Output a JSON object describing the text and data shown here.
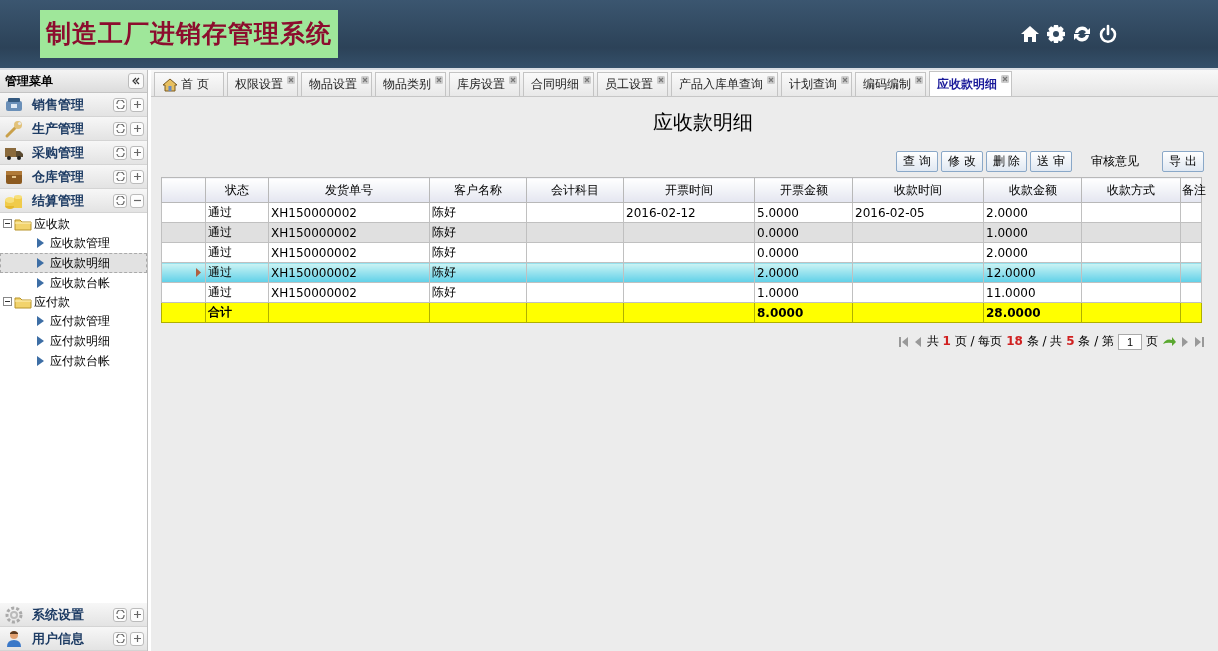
{
  "header": {
    "title": "制造工厂进销存管理系统"
  },
  "sidebar": {
    "title": "管理菜单",
    "groups": [
      {
        "label": "销售管理",
        "expanded": false
      },
      {
        "label": "生产管理",
        "expanded": false
      },
      {
        "label": "采购管理",
        "expanded": false
      },
      {
        "label": "仓库管理",
        "expanded": false
      },
      {
        "label": "结算管理",
        "expanded": true,
        "tree": [
          {
            "label": "应收款",
            "expanded": true,
            "children": [
              {
                "label": "应收款管理",
                "selected": false
              },
              {
                "label": "应收款明细",
                "selected": true
              },
              {
                "label": "应收款台帐",
                "selected": false
              }
            ]
          },
          {
            "label": "应付款",
            "expanded": true,
            "children": [
              {
                "label": "应付款管理",
                "selected": false
              },
              {
                "label": "应付款明细",
                "selected": false
              },
              {
                "label": "应付款台帐",
                "selected": false
              }
            ]
          }
        ]
      }
    ],
    "bottom_groups": [
      {
        "label": "系统设置",
        "expanded": false
      },
      {
        "label": "用户信息",
        "expanded": false
      }
    ]
  },
  "tabs": [
    {
      "label": "首 页",
      "selected": false,
      "closable": false
    },
    {
      "label": "权限设置",
      "selected": false,
      "closable": true
    },
    {
      "label": "物品设置",
      "selected": false,
      "closable": true
    },
    {
      "label": "物品类别",
      "selected": false,
      "closable": true
    },
    {
      "label": "库房设置",
      "selected": false,
      "closable": true
    },
    {
      "label": "合同明细",
      "selected": false,
      "closable": true
    },
    {
      "label": "员工设置",
      "selected": false,
      "closable": true
    },
    {
      "label": "产品入库单查询",
      "selected": false,
      "closable": true
    },
    {
      "label": "计划查询",
      "selected": false,
      "closable": true
    },
    {
      "label": "编码编制",
      "selected": false,
      "closable": true
    },
    {
      "label": "应收款明细",
      "selected": true,
      "closable": true
    }
  ],
  "page_title": "应收款明细",
  "toolbar": [
    {
      "kind": "button",
      "label": "查 询"
    },
    {
      "kind": "button",
      "label": "修 改"
    },
    {
      "kind": "button",
      "label": "删 除"
    },
    {
      "kind": "button",
      "label": "送 审"
    },
    {
      "kind": "label",
      "label": "审核意见"
    },
    {
      "kind": "button",
      "label": "导 出"
    }
  ],
  "table": {
    "columns": [
      "",
      "状态",
      "发货单号",
      "客户名称",
      "会计科目",
      "开票时间",
      "开票金额",
      "收款时间",
      "收款金额",
      "收款方式",
      "备注"
    ],
    "rows": [
      {
        "selected": false,
        "hover": false,
        "cells": [
          "",
          "通过",
          "XH150000002",
          "陈好",
          "",
          "2016-02-12",
          "5.0000",
          "2016-02-05",
          "2.0000",
          "",
          ""
        ]
      },
      {
        "selected": false,
        "hover": true,
        "cells": [
          "",
          "通过",
          "XH150000002",
          "陈好",
          "",
          "",
          "0.0000",
          "",
          "1.0000",
          "",
          ""
        ]
      },
      {
        "selected": false,
        "hover": false,
        "cells": [
          "",
          "通过",
          "XH150000002",
          "陈好",
          "",
          "",
          "0.0000",
          "",
          "2.0000",
          "",
          ""
        ]
      },
      {
        "selected": true,
        "hover": false,
        "cells": [
          "",
          "通过",
          "XH150000002",
          "陈好",
          "",
          "",
          "2.0000",
          "",
          "12.0000",
          "",
          ""
        ]
      },
      {
        "selected": false,
        "hover": false,
        "cells": [
          "",
          "通过",
          "XH150000002",
          "陈好",
          "",
          "",
          "1.0000",
          "",
          "11.0000",
          "",
          ""
        ]
      }
    ],
    "total": {
      "label": "合计",
      "invoice_amount": "8.0000",
      "received_amount": "28.0000"
    }
  },
  "pager": {
    "summary": "共 **1** 页 / 每页 **18** 条 / 共 **5** 条 / 第",
    "page": "1",
    "unit": "页"
  }
}
